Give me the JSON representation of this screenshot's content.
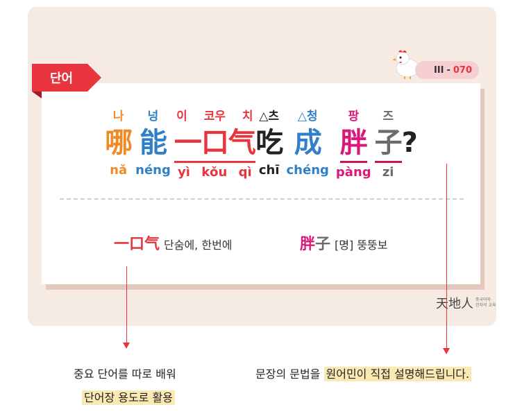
{
  "tag": {
    "label": "단어"
  },
  "badge": {
    "roman": "III",
    "sep": "-",
    "num": "070"
  },
  "sentence": [
    {
      "pron": "나",
      "hanzi": "哪",
      "pinyin": "nǎ",
      "color": "#f08a24"
    },
    {
      "pron": "넝",
      "hanzi": "能",
      "pinyin": "néng",
      "color": "#2f7fc9"
    },
    {
      "pron": "이 코우 치",
      "hanzi": "一口气",
      "pinyin": "yì kǒu qì",
      "color": "#e8343c"
    },
    {
      "pron": "△츠",
      "hanzi": "吃",
      "pinyin": "chī",
      "color": "#222222"
    },
    {
      "pron": "△청",
      "hanzi": "成",
      "pinyin": "chéng",
      "color": "#2f7fc9"
    },
    {
      "pron": "팡",
      "hanzi": "胖",
      "pinyin": "pàng",
      "color": "#d9197a"
    },
    {
      "pron": "즈",
      "hanzi": "子",
      "pinyin": "zi",
      "color": "#6b6b6b"
    },
    {
      "pron": "",
      "hanzi": "?",
      "pinyin": "",
      "color": "#222222"
    }
  ],
  "vocab": [
    {
      "word": "一口气",
      "meaning": "단숨에, 한번에",
      "color": "#e8343c"
    },
    {
      "word_a": "胖",
      "word_b": "子",
      "meaning": "[명] 뚱뚱보",
      "color_a": "#d9197a",
      "color_b": "#6b6b6b"
    }
  ],
  "logo": {
    "text": "天地人",
    "sub_line1": "중국어와",
    "sub_line2": "한자의 교육"
  },
  "captions": {
    "left_line1": "중요 단어를 따로 배워",
    "left_line2": "단어장 용도로 활용",
    "right_plain": "문장의 문법을",
    "right_highlight": "원어민이 직접 설명해드립니다."
  }
}
